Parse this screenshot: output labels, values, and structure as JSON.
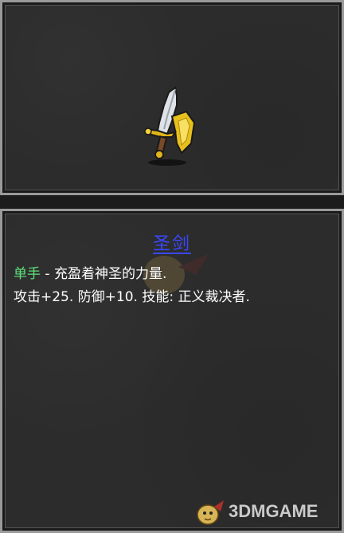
{
  "item": {
    "name": "圣剑",
    "icon": "holy-sword-icon"
  },
  "description": {
    "type_label": "单手",
    "separator": " - ",
    "flavor": "充盈着神圣的力量.",
    "stats": "攻击+25. 防御+10. 技能: 正义裁决者."
  },
  "watermark": {
    "text": "3DMGAME",
    "icon": "mascot-logo-icon"
  },
  "colors": {
    "name": "#3a47ff",
    "type_label": "#5ee07a",
    "text": "#ffffff",
    "panel_bg": "#2c2c2c",
    "frame": "#9a9a9a"
  }
}
